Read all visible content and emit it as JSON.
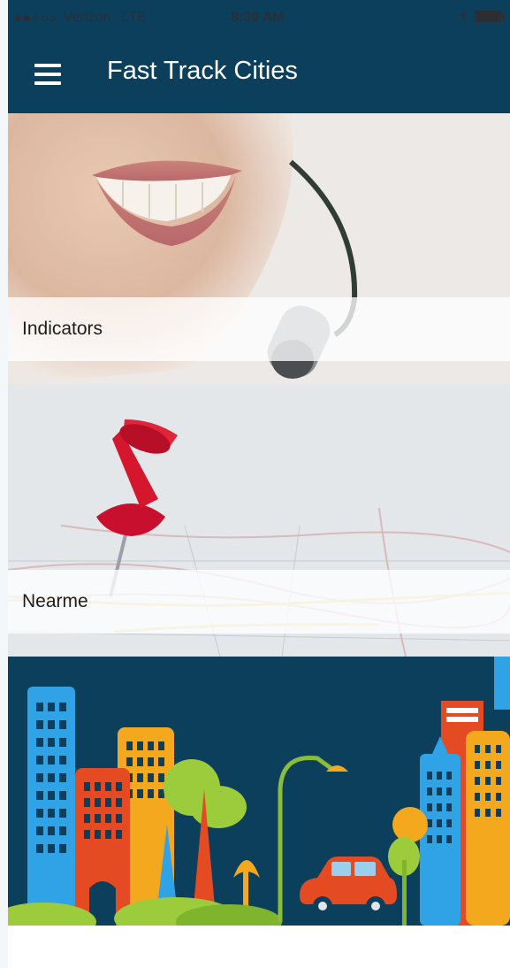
{
  "status_bar": {
    "carrier": "Verizon",
    "network": "LTE",
    "time": "8:30 AM",
    "signal_bars_filled": 2,
    "signal_bars_total": 5,
    "icons": [
      "location-arrow-icon",
      "battery-icon"
    ]
  },
  "nav": {
    "title": "Fast Track Cities",
    "menu_icon": "hamburger-menu-icon",
    "background_color": "#0b3f5c"
  },
  "tiles": [
    {
      "label": "Indicators",
      "image": "smiling-headset-person"
    },
    {
      "label": "Nearme",
      "image": "red-pushpin-on-map"
    },
    {
      "label": "",
      "image": "colorful-city-skyline"
    }
  ],
  "colors": {
    "brand": "#0b3f5c",
    "label_text": "#1d1d1d"
  }
}
